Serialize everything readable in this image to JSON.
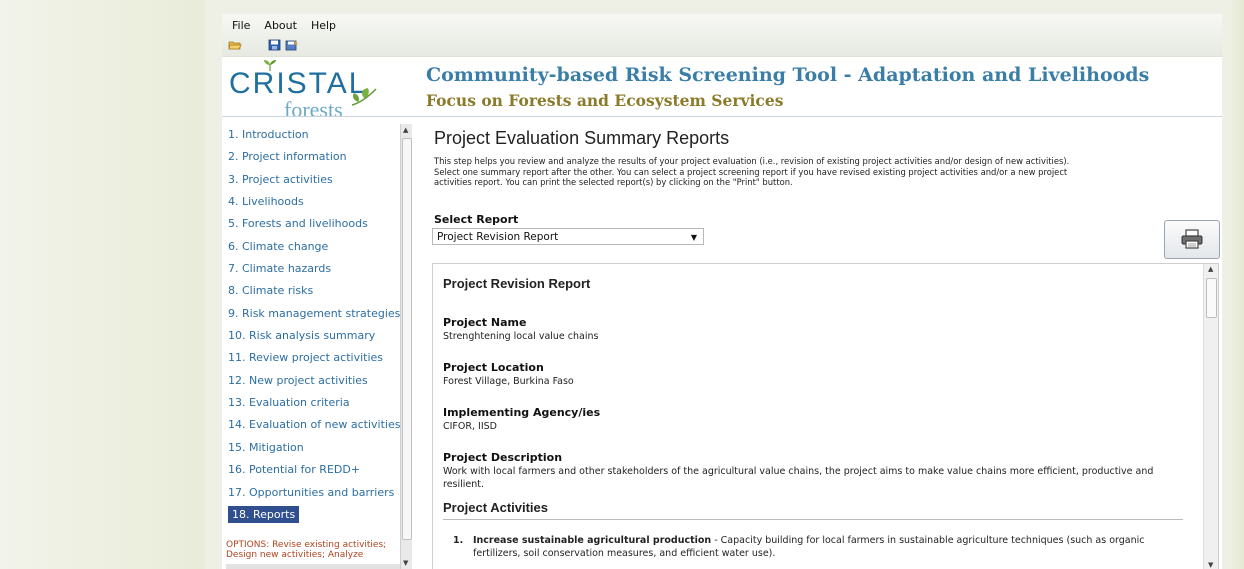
{
  "menu": {
    "file": "File",
    "about": "About",
    "help": "Help"
  },
  "toolbar": {
    "open_icon": "folder-open-icon",
    "save_icon": "save-icon",
    "saveas_icon": "save-as-icon"
  },
  "logo": {
    "line1": "CRISTAL",
    "line2": "forests"
  },
  "header": {
    "title": "Community-based Risk Screening Tool - Adaptation and Livelihoods",
    "subtitle": "Focus on Forests and Ecosystem Services",
    "title_color": "#3a7ea8",
    "subtitle_color": "#8b7a2a"
  },
  "sidebar": {
    "items": [
      "1. Introduction",
      "2. Project information",
      "3. Project activities",
      "4. Livelihoods",
      "5. Forests and livelihoods",
      "6. Climate change",
      "7. Climate hazards",
      "8. Climate risks",
      "9. Risk management strategies",
      "10. Risk analysis summary",
      "11. Review project activities",
      "12. New project activities",
      "13. Evaluation criteria",
      "14. Evaluation of new activities",
      "15. Mitigation",
      "16. Potential for REDD+",
      "17. Opportunities and barriers",
      "18. Reports"
    ],
    "active_index": 17,
    "options": "OPTIONS: Revise existing activities; Design new activities; Analyze",
    "link_color": "#2c6ea3",
    "active_bg": "#2f4f8f"
  },
  "main": {
    "title": "Project Evaluation Summary Reports",
    "intro": "This step helps you review and analyze the results of your project evaluation (i.e., revision of existing project activities and/or design of new activities). Select one summary report after the other. You can select a project screening report if you have revised existing project activities and/or a new project activities report. You can print the selected report(s) by clicking on the \"Print\" button.",
    "select_label": "Select Report",
    "select_value": "Project Revision Report",
    "print_icon": "printer-icon"
  },
  "report": {
    "title": "Project Revision Report",
    "name_label": "Project Name",
    "name_value": "Strenghtening local value chains",
    "location_label": "Project Location",
    "location_value": "Forest Village, Burkina Faso",
    "agency_label": "Implementing Agency/ies",
    "agency_value": "CIFOR, IISD",
    "description_label": "Project Description",
    "description_value": "Work with local farmers and other stakeholders of the agricultural value chains, the project aims to make value chains more efficient, productive and resilient.",
    "activities_label": "Project Activities",
    "activities": [
      {
        "num": "1.",
        "title": "Increase sustainable agricultural production",
        "text": " - Capacity building for local farmers in sustainable agriculture techniques (such as organic fertilizers, soil conservation measures, and efficient water use)."
      }
    ]
  }
}
